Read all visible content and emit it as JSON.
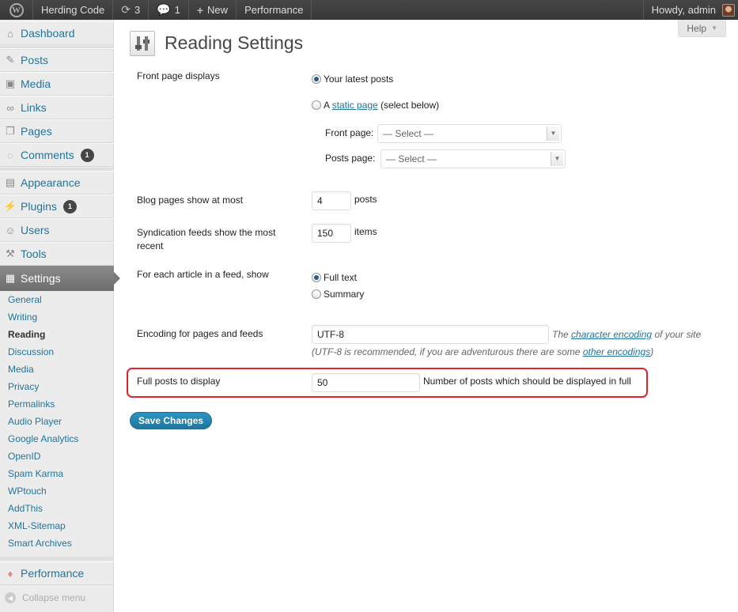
{
  "adminbar": {
    "wp_logo": "W",
    "site_name": "Herding Code",
    "updates_count": "3",
    "comments_count": "1",
    "new_label": "New",
    "performance_label": "Performance",
    "howdy": "Howdy, admin"
  },
  "sidebar": {
    "items": [
      {
        "label": "Dashboard",
        "icon": "house-icon"
      },
      {
        "label": "Posts",
        "icon": "pin-icon"
      },
      {
        "label": "Media",
        "icon": "media-icon"
      },
      {
        "label": "Links",
        "icon": "link-icon"
      },
      {
        "label": "Pages",
        "icon": "pages-icon"
      },
      {
        "label": "Comments",
        "icon": "comment-icon",
        "badge": "1"
      },
      {
        "label": "Appearance",
        "icon": "appearance-icon"
      },
      {
        "label": "Plugins",
        "icon": "plug-icon",
        "badge": "1"
      },
      {
        "label": "Users",
        "icon": "users-icon"
      },
      {
        "label": "Tools",
        "icon": "tools-icon"
      },
      {
        "label": "Settings",
        "icon": "settings-icon"
      }
    ],
    "submenu": [
      "General",
      "Writing",
      "Reading",
      "Discussion",
      "Media",
      "Privacy",
      "Permalinks",
      "Audio Player",
      "Google Analytics",
      "OpenID",
      "Spam Karma",
      "WPtouch",
      "AddThis",
      "XML-Sitemap",
      "Smart Archives"
    ],
    "performance_label": "Performance",
    "collapse_label": "Collapse menu"
  },
  "page": {
    "help_label": "Help",
    "title": "Reading Settings",
    "front_page": {
      "label": "Front page displays",
      "opt_latest": "Your latest posts",
      "opt_static_prefix": "A",
      "opt_static_link": "static page",
      "opt_static_suffix": "(select below)",
      "front_page_label": "Front page:",
      "front_page_value": "— Select —",
      "posts_page_label": "Posts page:",
      "posts_page_value": "— Select —"
    },
    "blog_pages": {
      "label": "Blog pages show at most",
      "value": "4",
      "unit": "posts"
    },
    "syndication": {
      "label": "Syndication feeds show the most recent",
      "value": "150",
      "unit": "items"
    },
    "feed_article": {
      "label": "For each article in a feed, show",
      "opt_full": "Full text",
      "opt_summary": "Summary"
    },
    "encoding": {
      "label": "Encoding for pages and feeds",
      "value": "UTF-8",
      "desc_prefix": "The",
      "desc_link": "character encoding",
      "desc_suffix": "of your site",
      "note_prefix": "(UTF-8 is recommended, if you are adventurous there are some",
      "note_link": "other encodings",
      "note_suffix": ")"
    },
    "full_posts": {
      "label": "Full posts to display",
      "value": "50",
      "desc": "Number of posts which should be displayed in full"
    },
    "save_label": "Save Changes"
  },
  "colors": {
    "link": "#21759b",
    "highlight": "#e0232b",
    "button": "#21759b"
  }
}
